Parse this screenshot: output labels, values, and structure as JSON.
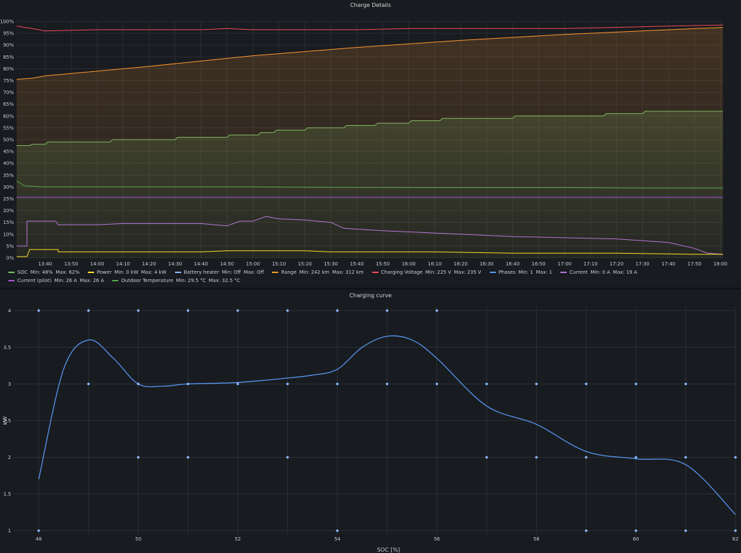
{
  "panel1": {
    "title": "Charge Details",
    "chart_data": {
      "type": "line",
      "title": "Charge Details",
      "ylim": [
        0,
        100
      ],
      "y_ticks": [
        "0%",
        "5%",
        "10%",
        "15%",
        "20%",
        "25%",
        "30%",
        "35%",
        "40%",
        "45%",
        "50%",
        "55%",
        "60%",
        "65%",
        "70%",
        "75%",
        "80%",
        "85%",
        "90%",
        "95%",
        "100%"
      ],
      "x_ticks": [
        "13:40",
        "13:50",
        "14:00",
        "14:10",
        "14:20",
        "14:30",
        "14:40",
        "14:50",
        "15:00",
        "15:10",
        "15:20",
        "15:30",
        "15:40",
        "15:50",
        "16:00",
        "16:10",
        "16:20",
        "16:30",
        "16:40",
        "16:50",
        "17:00",
        "17:10",
        "17:20",
        "17:30",
        "17:40",
        "17:50",
        "18:00"
      ],
      "x_minutes": [
        0,
        10,
        20,
        30,
        40,
        50,
        60,
        70,
        80,
        90,
        100,
        110,
        120,
        130,
        140,
        150,
        160,
        170,
        180,
        190,
        200,
        210,
        220,
        230,
        240,
        250,
        260
      ],
      "x_range": [
        -11,
        261
      ],
      "series": [
        {
          "name": "SOC",
          "color": "#73bf69",
          "fill": true,
          "points": [
            [
              -11,
              47.5
            ],
            [
              -6,
              47.5
            ],
            [
              -5,
              48
            ],
            [
              0,
              48
            ],
            [
              1,
              49
            ],
            [
              25,
              49
            ],
            [
              26,
              50
            ],
            [
              50,
              50
            ],
            [
              51,
              51
            ],
            [
              70,
              51
            ],
            [
              71,
              52
            ],
            [
              82,
              52
            ],
            [
              83,
              53
            ],
            [
              88,
              53
            ],
            [
              89,
              54
            ],
            [
              100,
              54
            ],
            [
              101,
              55
            ],
            [
              115,
              55
            ],
            [
              116,
              56
            ],
            [
              127,
              56
            ],
            [
              128,
              57
            ],
            [
              140,
              57
            ],
            [
              141,
              58
            ],
            [
              152,
              58
            ],
            [
              153,
              59
            ],
            [
              180,
              59
            ],
            [
              181,
              60
            ],
            [
              215,
              60
            ],
            [
              216,
              61
            ],
            [
              230,
              61
            ],
            [
              231,
              62
            ],
            [
              261,
              62
            ]
          ]
        },
        {
          "name": "Range",
          "color": "#ff9830",
          "fill": true,
          "points": [
            [
              -11,
              75.5
            ],
            [
              -5,
              76
            ],
            [
              0,
              77
            ],
            [
              40,
              81
            ],
            [
              80,
              85.5
            ],
            [
              120,
              89
            ],
            [
              160,
              92
            ],
            [
              200,
              94.5
            ],
            [
              240,
              96.5
            ],
            [
              261,
              97.5
            ]
          ]
        },
        {
          "name": "Charging Voltage",
          "color": "#f2495c",
          "fill": false,
          "points": [
            [
              -11,
              98
            ],
            [
              -5,
              97
            ],
            [
              0,
              96
            ],
            [
              20,
              96.5
            ],
            [
              40,
              96.5
            ],
            [
              60,
              96.5
            ],
            [
              70,
              97
            ],
            [
              80,
              96.5
            ],
            [
              100,
              96.5
            ],
            [
              120,
              96.5
            ],
            [
              140,
              97
            ],
            [
              160,
              97
            ],
            [
              180,
              97
            ],
            [
              200,
              97
            ],
            [
              220,
              97.5
            ],
            [
              240,
              98
            ],
            [
              261,
              98.5
            ]
          ]
        },
        {
          "name": "Outdoor Temperature",
          "color": "#56a64b",
          "fill": false,
          "points": [
            [
              -11,
              32.5
            ],
            [
              -8,
              30.5
            ],
            [
              0,
              30
            ],
            [
              40,
              30
            ],
            [
              80,
              30
            ],
            [
              110,
              29.8
            ],
            [
              140,
              29.7
            ],
            [
              200,
              29.7
            ],
            [
              230,
              29.5
            ],
            [
              261,
              29.5
            ]
          ]
        },
        {
          "name": "Phases",
          "color": "#8ab8ff",
          "fill": false,
          "points": [
            [
              -11,
              25.6
            ],
            [
              261,
              25.6
            ]
          ]
        },
        {
          "name": "Current (pilot)",
          "color": "#8f3bb8",
          "fill": false,
          "points": [
            [
              -11,
              25.6
            ],
            [
              261,
              25.6
            ]
          ]
        },
        {
          "name": "Current",
          "color": "#b877d9",
          "fill": false,
          "points": [
            [
              -11,
              5
            ],
            [
              -7,
              5
            ],
            [
              -7,
              15.5
            ],
            [
              0,
              15.5
            ],
            [
              4,
              15.5
            ],
            [
              5,
              14
            ],
            [
              20,
              14
            ],
            [
              30,
              14.5
            ],
            [
              50,
              14.5
            ],
            [
              60,
              14.5
            ],
            [
              70,
              13.5
            ],
            [
              75,
              15.5
            ],
            [
              80,
              15.5
            ],
            [
              85,
              17.5
            ],
            [
              90,
              16.5
            ],
            [
              100,
              16
            ],
            [
              110,
              15
            ],
            [
              115,
              12.5
            ],
            [
              130,
              11.5
            ],
            [
              150,
              10.5
            ],
            [
              170,
              9.5
            ],
            [
              180,
              9
            ],
            [
              200,
              8.5
            ],
            [
              220,
              8
            ],
            [
              240,
              6.5
            ],
            [
              250,
              4
            ],
            [
              255,
              2
            ],
            [
              261,
              1.5
            ]
          ]
        },
        {
          "name": "Power",
          "color": "#fade2a",
          "fill": false,
          "points": [
            [
              -11,
              0.5
            ],
            [
              -7,
              0.5
            ],
            [
              -6,
              3.5
            ],
            [
              5,
              3.5
            ],
            [
              5,
              2.5
            ],
            [
              60,
              2.5
            ],
            [
              70,
              3
            ],
            [
              100,
              3
            ],
            [
              110,
              2.5
            ],
            [
              150,
              2.5
            ],
            [
              180,
              2
            ],
            [
              220,
              2
            ],
            [
              250,
              1.5
            ],
            [
              261,
              1.5
            ]
          ]
        }
      ]
    },
    "legend": [
      {
        "name": "SOC",
        "color": "#73bf69",
        "min": "Min: 48%",
        "max": "Max: 62%"
      },
      {
        "name": "Power",
        "color": "#fade2a",
        "min": "Min: 0 kW",
        "max": "Max: 4 kW"
      },
      {
        "name": "Battery heater",
        "color": "#8ab8ff",
        "min": "Min: Off",
        "max": "Max: Off"
      },
      {
        "name": "Range",
        "color": "#ff9830",
        "min": "Min: 242 km",
        "max": "Max: 312 km"
      },
      {
        "name": "Charging Voltage",
        "color": "#f2495c",
        "min": "Min: 225 V",
        "max": "Max: 235 V"
      },
      {
        "name": "Phases",
        "color": "#5794f2",
        "min": "Min: 1",
        "max": "Max: 1"
      },
      {
        "name": "Current",
        "color": "#b877d9",
        "min": "Min: 0 A",
        "max": "Max: 19 A"
      },
      {
        "name": "Current (pilot)",
        "color": "#a352cc",
        "min": "Min: 26 A",
        "max": "Max: 26 A"
      },
      {
        "name": "Outdoor Temperature",
        "color": "#56a64b",
        "min": "Min: 29.5 °C",
        "max": "Max: 32.5 °C"
      }
    ]
  },
  "panel2": {
    "title": "Charging curve",
    "chart_data": {
      "type": "scatter",
      "title": "Charging curve",
      "xlabel": "SOC [%]",
      "ylabel": "kW",
      "xlim": [
        47.5,
        62
      ],
      "ylim": [
        0.95,
        4.05
      ],
      "x_ticks": [
        48,
        50,
        52,
        54,
        56,
        58,
        60,
        62
      ],
      "y_ticks": [
        1,
        1.5,
        2,
        2.5,
        3,
        3.5,
        4
      ],
      "color": "#8ab8ff",
      "points": [
        [
          48,
          4
        ],
        [
          49,
          4
        ],
        [
          50,
          4
        ],
        [
          51,
          4
        ],
        [
          52,
          4
        ],
        [
          53,
          4
        ],
        [
          54,
          4
        ],
        [
          55,
          4
        ],
        [
          56,
          4
        ],
        [
          49,
          3
        ],
        [
          50,
          3
        ],
        [
          51,
          3
        ],
        [
          52,
          3
        ],
        [
          53,
          3
        ],
        [
          54,
          3
        ],
        [
          55,
          3
        ],
        [
          56,
          3
        ],
        [
          57,
          3
        ],
        [
          58,
          3
        ],
        [
          59,
          3
        ],
        [
          60,
          3
        ],
        [
          61,
          3
        ],
        [
          50,
          2
        ],
        [
          51,
          2
        ],
        [
          53,
          2
        ],
        [
          57,
          2
        ],
        [
          58,
          2
        ],
        [
          59,
          2
        ],
        [
          60,
          2
        ],
        [
          61,
          2
        ],
        [
          62,
          2
        ],
        [
          48,
          1
        ],
        [
          54,
          1
        ],
        [
          59,
          1
        ],
        [
          60,
          1
        ],
        [
          61,
          1
        ],
        [
          62,
          1
        ]
      ],
      "trend": [
        [
          48,
          1.7
        ],
        [
          48.5,
          3.2
        ],
        [
          49,
          3.6
        ],
        [
          49.5,
          3.35
        ],
        [
          50,
          3.0
        ],
        [
          50.5,
          2.97
        ],
        [
          51,
          3.0
        ],
        [
          52,
          3.02
        ],
        [
          53,
          3.08
        ],
        [
          53.5,
          3.12
        ],
        [
          54,
          3.2
        ],
        [
          54.5,
          3.5
        ],
        [
          55,
          3.65
        ],
        [
          55.5,
          3.6
        ],
        [
          56,
          3.35
        ],
        [
          57,
          2.7
        ],
        [
          58,
          2.45
        ],
        [
          59,
          2.08
        ],
        [
          60,
          1.98
        ],
        [
          61,
          1.9
        ],
        [
          62,
          1.22
        ]
      ]
    }
  }
}
